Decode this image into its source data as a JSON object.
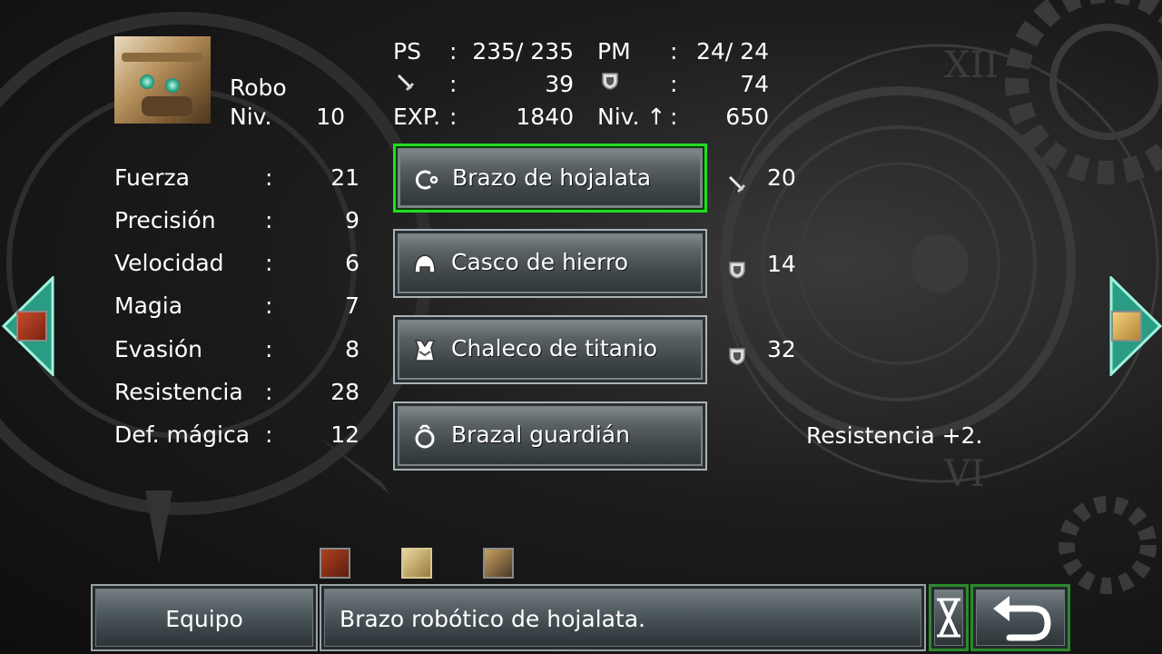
{
  "character": {
    "name": "Robo",
    "level_label": "Niv.",
    "level": "10"
  },
  "top_stats": {
    "hp_label": "PS",
    "hp": "235/ 235",
    "mp_label": "PM",
    "mp": "24/ 24",
    "attack": "39",
    "defense": "74",
    "exp_label": "EXP.",
    "exp": "1840",
    "next_label": "Niv. ↑",
    "next": "650",
    "colon": ":"
  },
  "attributes": [
    {
      "label": "Fuerza",
      "value": "21"
    },
    {
      "label": "Precisión",
      "value": "9"
    },
    {
      "label": "Velocidad",
      "value": "6"
    },
    {
      "label": "Magia",
      "value": "7"
    },
    {
      "label": "Evasión",
      "value": "8"
    },
    {
      "label": "Resistencia",
      "value": "28"
    },
    {
      "label": "Def. mágica",
      "value": "12"
    }
  ],
  "equipment": [
    {
      "slot": "weapon",
      "name": "Brazo de hojalata",
      "stat": "20",
      "stat_icon": "sword-icon"
    },
    {
      "slot": "helmet",
      "name": "Casco de hierro",
      "stat": "14",
      "stat_icon": "shield-icon"
    },
    {
      "slot": "armor",
      "name": "Chaleco de titanio",
      "stat": "32",
      "stat_icon": "shield-icon"
    },
    {
      "slot": "accessory",
      "name": "Brazal guardián",
      "stat": "Resistencia +2.",
      "stat_icon": ""
    }
  ],
  "bottom": {
    "menu_label": "Equipo",
    "description": "Brazo robótico de hojalata."
  },
  "colors": {
    "selected_border": "#22dd22",
    "nav_arrow": "#3fc0a0"
  }
}
